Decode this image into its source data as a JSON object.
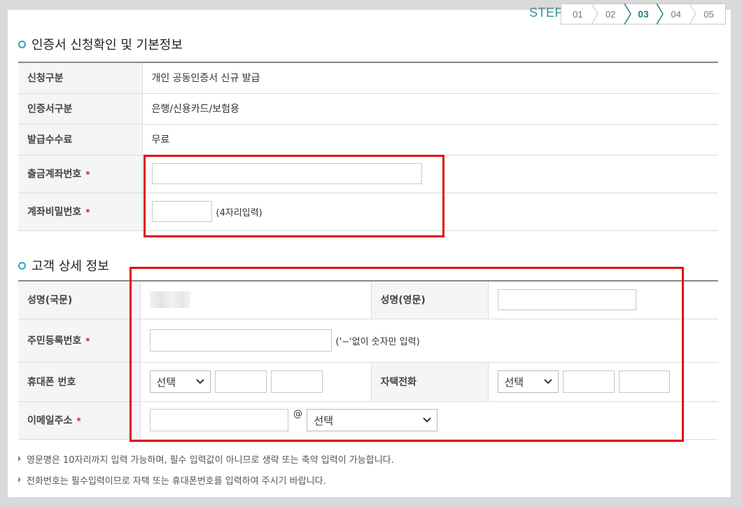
{
  "steps": {
    "label": "STEP",
    "items": [
      "01",
      "02",
      "03",
      "04",
      "05"
    ],
    "active_index": 2
  },
  "section1": {
    "title": "인증서 신청확인 및 기본정보",
    "rows": {
      "apply_type_label": "신청구분",
      "apply_type_value": "개인 공동인증서 신규 발급",
      "cert_type_label": "인증서구분",
      "cert_type_value": "은행/신용카드/보험용",
      "fee_label": "발급수수료",
      "fee_value": "무료",
      "account_label": "출금계좌번호",
      "account_value": "",
      "password_label": "계좌비밀번호",
      "password_value": "",
      "password_hint": "(4자리입력)"
    },
    "required_mark": "*"
  },
  "section2": {
    "title": "고객 상세 정보",
    "name_kr_label": "성명(국문)",
    "name_en_label": "성명(영문)",
    "name_en_value": "",
    "rrn_label": "주민등록번호",
    "rrn_value": "",
    "rrn_hint": "('−'없이 숫자만 입력)",
    "mobile_label": "휴대폰 번호",
    "mobile_select": "선택",
    "home_phone_label": "자택전화",
    "home_phone_select": "선택",
    "email_label": "이메일주소",
    "email_value": "",
    "email_at": "@",
    "email_domain_select": "선택"
  },
  "notes": [
    "영문명은 10자리까지 입력 가능하며, 필수 입력값이 아니므로 생략 또는 축약 입력이 가능합니다.",
    "전화번호는 필수입력이므로 자택 또는 휴대폰번호를 입력하여 주시기 바랍니다."
  ],
  "colors": {
    "accent": "#2aa8b8",
    "highlight": "#e01010",
    "required": "#d02020"
  }
}
